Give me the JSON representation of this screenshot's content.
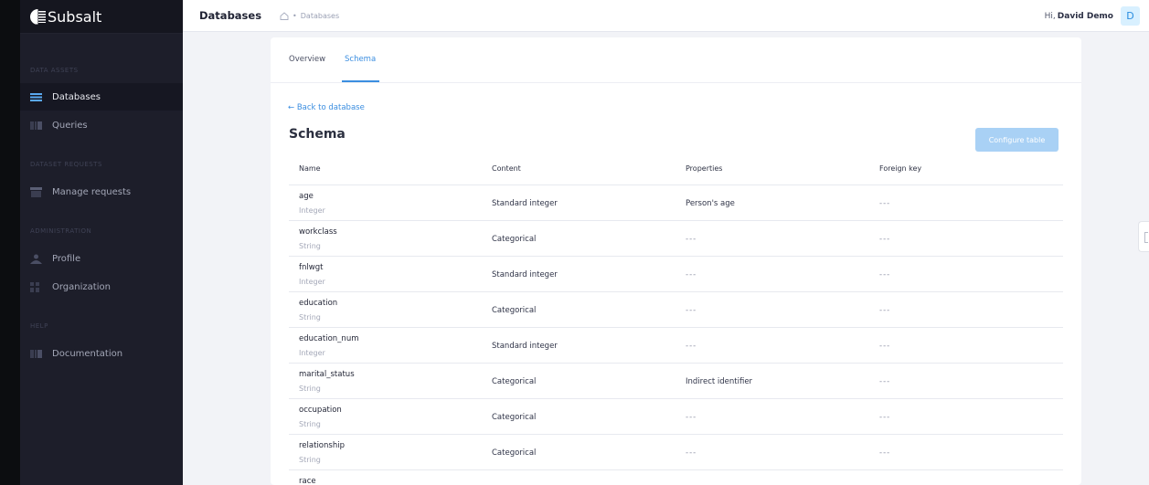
{
  "app": {
    "name": "Subsalt"
  },
  "sidebar": {
    "sections": [
      {
        "title": "DATA ASSETS"
      },
      {
        "title": "DATASET REQUESTS"
      },
      {
        "title": "ADMINISTRATION"
      },
      {
        "title": "HELP"
      }
    ],
    "items": [
      {
        "label": "Databases",
        "icon": "database-icon",
        "active": true
      },
      {
        "label": "Queries",
        "icon": "queries-icon"
      },
      {
        "label": "Manage requests",
        "icon": "requests-icon"
      },
      {
        "label": "Profile",
        "icon": "profile-icon"
      },
      {
        "label": "Organization",
        "icon": "organization-icon"
      },
      {
        "label": "Documentation",
        "icon": "documentation-icon"
      }
    ]
  },
  "header": {
    "title": "Databases",
    "breadcrumb": "Databases",
    "greeting": "Hi,",
    "user_name": "David Demo",
    "avatar_letter": "D"
  },
  "tabs": [
    {
      "label": "Overview",
      "active": false
    },
    {
      "label": "Schema",
      "active": true
    }
  ],
  "back_link": "← Back to database",
  "schema": {
    "title": "Schema",
    "configure_label": "Configure table",
    "columns": [
      "Name",
      "Content",
      "Properties",
      "Foreign key"
    ],
    "rows": [
      {
        "name": "age",
        "type": "Integer",
        "content": "Standard integer",
        "properties": "Person's age",
        "foreign_key": "---"
      },
      {
        "name": "workclass",
        "type": "String",
        "content": "Categorical",
        "properties": "---",
        "foreign_key": "---"
      },
      {
        "name": "fnlwgt",
        "type": "Integer",
        "content": "Standard integer",
        "properties": "---",
        "foreign_key": "---"
      },
      {
        "name": "education",
        "type": "String",
        "content": "Categorical",
        "properties": "---",
        "foreign_key": "---"
      },
      {
        "name": "education_num",
        "type": "Integer",
        "content": "Standard integer",
        "properties": "---",
        "foreign_key": "---"
      },
      {
        "name": "marital_status",
        "type": "String",
        "content": "Categorical",
        "properties": "Indirect identifier",
        "foreign_key": "---"
      },
      {
        "name": "occupation",
        "type": "String",
        "content": "Categorical",
        "properties": "---",
        "foreign_key": "---"
      },
      {
        "name": "relationship",
        "type": "String",
        "content": "Categorical",
        "properties": "---",
        "foreign_key": "---"
      },
      {
        "name": "race",
        "type": "",
        "content": "",
        "properties": "",
        "foreign_key": ""
      }
    ]
  },
  "colors": {
    "accent": "#3b8ee0",
    "sidebar": "#1d1e2a",
    "button_disabled": "#a9d1f5"
  }
}
